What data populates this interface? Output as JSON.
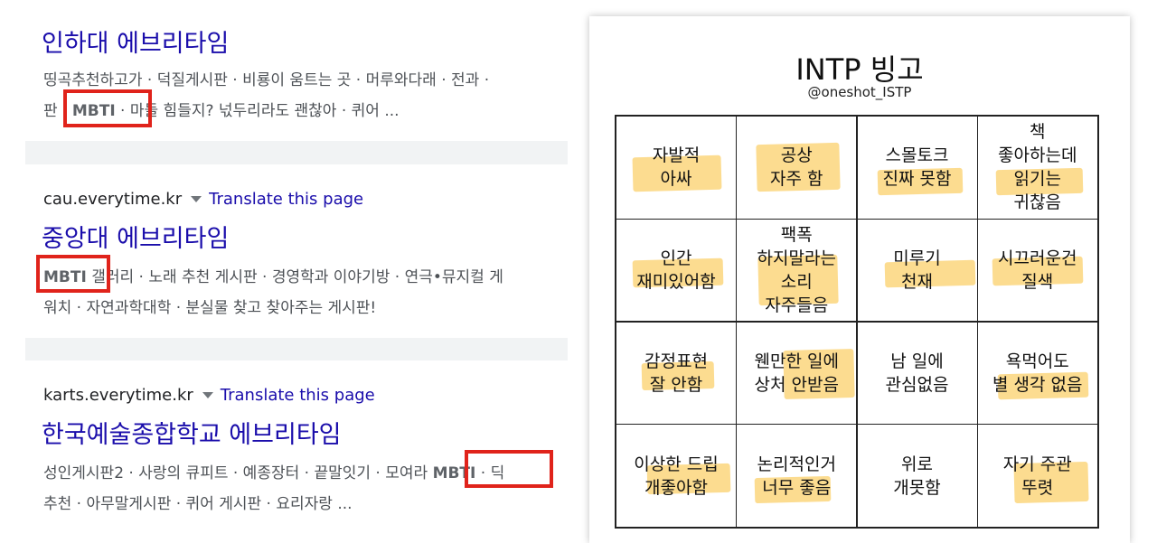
{
  "search_results": [
    {
      "title": "인하대 에브리타임",
      "snippet_line1": "띵곡추천하고가 · 덕질게시판 · 비룡이 움트는 곳 · 머루와다래 · 전과 ·",
      "snippet_line2_before": "판 · ",
      "snippet_line2_keyword": "MBTI",
      "snippet_line2_after": " · 마들 힘들지? 넋두리라도 괜찮아 · 퀴어 ..."
    },
    {
      "domain": "cau.everytime.kr",
      "translate": "Translate this page",
      "title": "중앙대 에브리타임",
      "snippet_line1_keyword": "MBTI",
      "snippet_line1_after": " 갤러리 · 노래 추천 게시판 · 경영학과 이야기방 · 연극•뮤지컬 게",
      "snippet_line2": "워치 · 자연과학대학 · 분실물 찾고 찾아주는 게시판!"
    },
    {
      "domain": "karts.everytime.kr",
      "translate": "Translate this page",
      "title": "한국예술종합학교 에브리타임",
      "snippet_line1_before": "성인게시판2 · 사랑의 큐피트 · 예종장터 · 끝말잇기 · 모여라 ",
      "snippet_line1_keyword": "MBTI",
      "snippet_line1_after": " · 딕",
      "snippet_line2": "추천 · 아무말게시판 · 퀴어 게시판 · 요리자랑 ..."
    }
  ],
  "bingo": {
    "title": "INTP 빙고",
    "author": "@oneshot_ISTP",
    "cells": [
      "자발적\n아싸",
      "공상\n자주 함",
      "스몰토크\n진짜 못함",
      "책\n좋아하는데\n읽기는\n귀찮음",
      "인간\n재미있어함",
      "팩폭\n하지말라는\n소리\n자주들음",
      "미루기\n천재",
      "시끄러운건\n질색",
      "감정표현\n잘 안함",
      "웬만한 일에\n상처 안받음",
      "남 일에\n관심없음",
      "욕먹어도\n별 생각 없음",
      "이상한 드립\n개좋아함",
      "논리적인거\n너무 좋음",
      "위로\n개못함",
      "자기 주관\n뚜렷"
    ]
  },
  "colors": {
    "link": "#1a0dab",
    "highlight_box": "#e0231b",
    "marker": "#fac446"
  }
}
